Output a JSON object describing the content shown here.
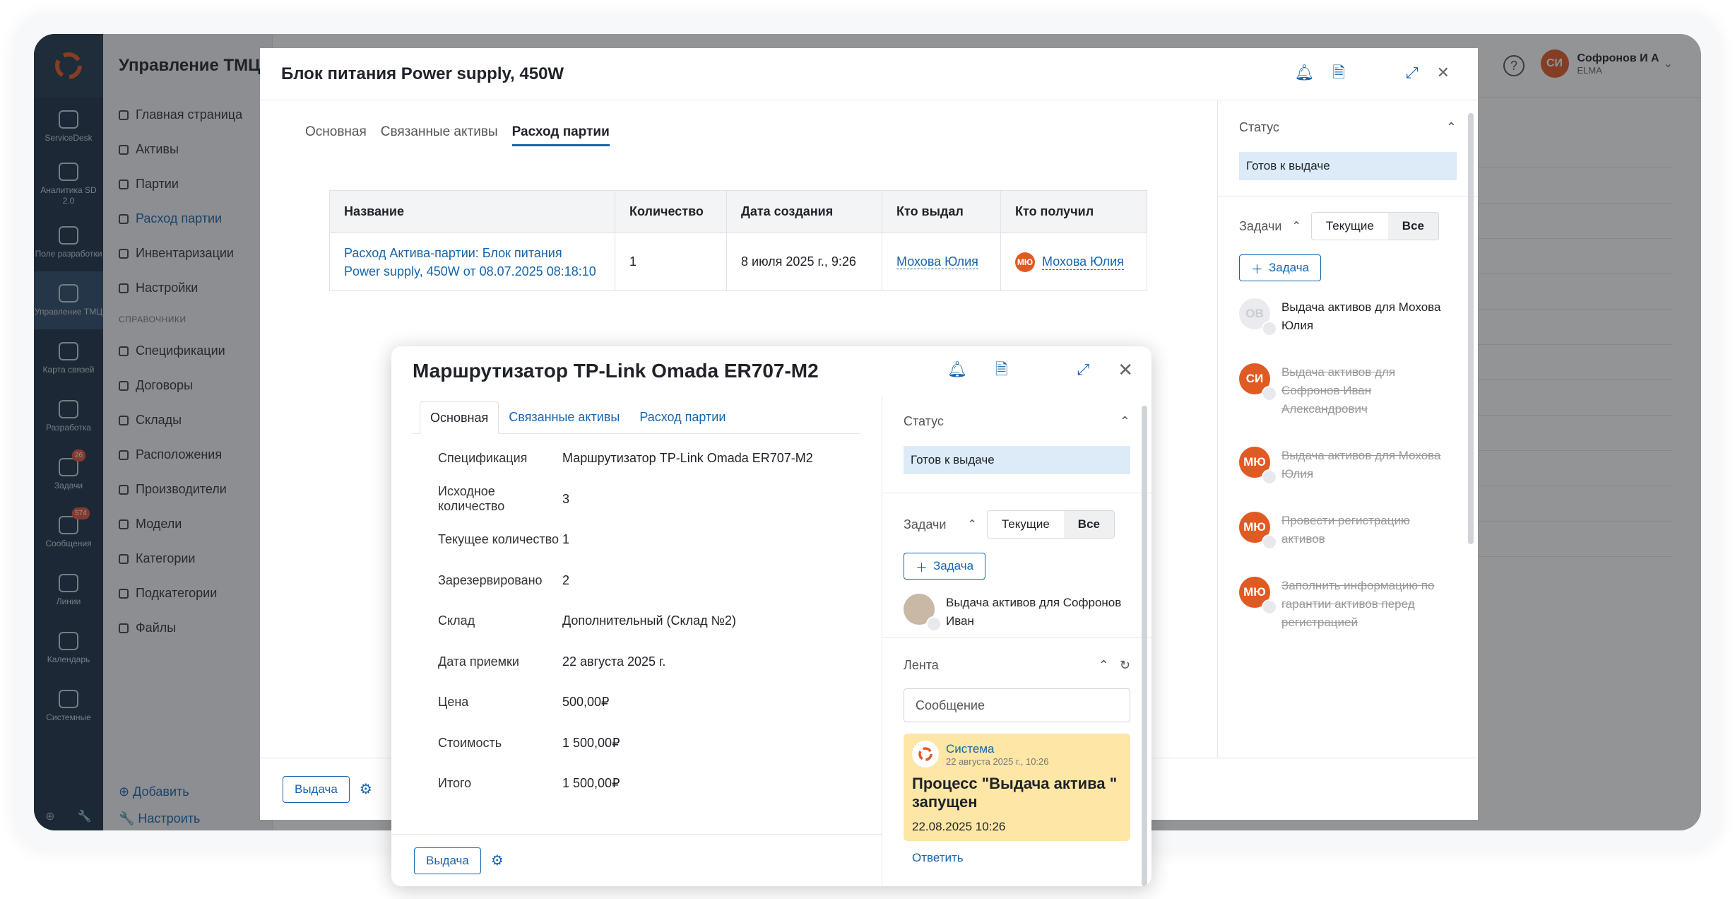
{
  "app": {
    "title": "Управление ТМЦ",
    "user_initials": "СИ",
    "user_name": "Софронов И А",
    "user_org": "ELMA",
    "help": "?"
  },
  "rail": [
    {
      "label": "ServiceDesk"
    },
    {
      "label": "Аналитика SD 2.0"
    },
    {
      "label": "Поле разработки"
    },
    {
      "label": "Управление ТМЦ"
    },
    {
      "label": "Карта связей"
    },
    {
      "label": "Разработка"
    },
    {
      "label": "Задачи",
      "badge": "26"
    },
    {
      "label": "Сообщения",
      "badge": "574"
    },
    {
      "label": "Линии"
    },
    {
      "label": "Календарь"
    },
    {
      "label": "Системные"
    }
  ],
  "sidebar": {
    "items": [
      "Главная страница",
      "Активы",
      "Партии",
      "Расход партии",
      "Инвентаризации",
      "Настройки"
    ],
    "section": "СПРАВОЧНИКИ",
    "refs": [
      "Спецификации",
      "Договоры",
      "Склады",
      "Расположения",
      "Производители",
      "Модели",
      "Категории",
      "Подкатегории",
      "Файлы"
    ],
    "add": "Добавить",
    "configure": "Настроить"
  },
  "modal1": {
    "title": "Блок питания Power supply, 450W",
    "tabs": [
      "Основная",
      "Связанные активы",
      "Расход партии"
    ],
    "columns": [
      "Название",
      "Количество",
      "Дата создания",
      "Кто выдал",
      "Кто получил"
    ],
    "row": {
      "name": "Расход Актива-партии: Блок питания Power supply, 450W от 08.07.2025 08:18:10",
      "qty": "1",
      "date": "8 июля 2025 г., 9:26",
      "issuer": "Мохова Юлия",
      "receiver": "Мохова Юлия",
      "receiver_initials": "МЮ"
    },
    "status_label": "Статус",
    "status_value": "Готов к выдаче",
    "tasks_label": "Задачи",
    "seg_current": "Текущие",
    "seg_all": "Все",
    "add_task": "Задача",
    "tasks": [
      {
        "initials": "ОВ",
        "text": "Выдача активов для Мохова Юлия",
        "done": false,
        "color": "#e9ebee"
      },
      {
        "initials": "СИ",
        "text": "Выдача активов для Софронов Иван Александрович",
        "done": true,
        "color": "#e05a24"
      },
      {
        "initials": "МЮ",
        "text": "Выдача активов для Мохова Юлия",
        "done": true,
        "color": "#e05a24"
      },
      {
        "initials": "МЮ",
        "text": "Провести регистрацию активов",
        "done": true,
        "color": "#e05a24"
      },
      {
        "initials": "МЮ",
        "text": "Заполнить информацию по гарантии активов перед регистрацией",
        "done": true,
        "color": "#e05a24"
      }
    ],
    "issue_button": "Выдача"
  },
  "modal2": {
    "title": "Маршрутизатор TP-Link Omada ER707-M2",
    "tabs": [
      "Основная",
      "Связанные активы",
      "Расход партии"
    ],
    "props": [
      {
        "k": "Спецификация",
        "v": "Маршрутизатор TP-Link Omada ER707-M2",
        "link": true
      },
      {
        "k": "Исходное количество",
        "v": "3"
      },
      {
        "k": "Текущее количество",
        "v": "1"
      },
      {
        "k": "Зарезервировано",
        "v": "2"
      },
      {
        "k": "Склад",
        "v": "Дополнительный (Склад №2)",
        "link": true
      },
      {
        "k": "Дата приемки",
        "v": "22 августа 2025 г."
      },
      {
        "k": "Цена",
        "v": "500,00₽"
      },
      {
        "k": "Стоимость",
        "v": "1 500,00₽"
      },
      {
        "k": "Итого",
        "v": "1 500,00₽"
      }
    ],
    "status_label": "Статус",
    "status_value": "Готов к выдаче",
    "tasks_label": "Задачи",
    "seg_current": "Текущие",
    "seg_all": "Все",
    "add_task": "Задача",
    "task": "Выдача активов для Софронов Иван",
    "feed_label": "Лента",
    "feed_placeholder": "Сообщение",
    "feed": {
      "author": "Система",
      "time": "22 августа 2025 г., 10:26",
      "text": "Процесс \"Выдача актива \" запущен",
      "date": "22.08.2025 10:26",
      "reply": "Ответить"
    },
    "issue_button": "Выдача"
  }
}
